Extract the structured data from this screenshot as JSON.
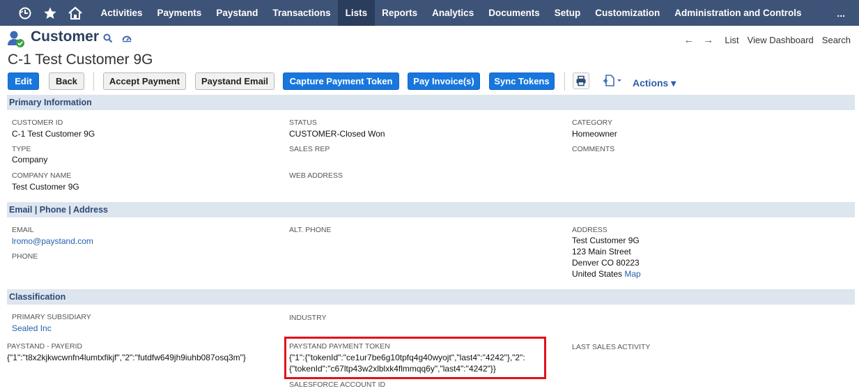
{
  "nav": {
    "items": [
      "Activities",
      "Payments",
      "Paystand",
      "Transactions",
      "Lists",
      "Reports",
      "Analytics",
      "Documents",
      "Setup",
      "Customization",
      "Administration and Controls"
    ],
    "active": "Lists",
    "more": "..."
  },
  "record": {
    "type": "Customer",
    "title": "C-1 Test Customer 9G"
  },
  "right_links": {
    "list": "List",
    "dashboard": "View Dashboard",
    "search": "Search"
  },
  "buttons": {
    "edit": "Edit",
    "back": "Back",
    "accept_payment": "Accept Payment",
    "paystand_email": "Paystand Email",
    "capture_token": "Capture Payment Token",
    "pay_invoices": "Pay Invoice(s)",
    "sync_tokens": "Sync Tokens",
    "actions": "Actions ▾"
  },
  "sections": {
    "primary": "Primary Information",
    "contact": "Email | Phone | Address",
    "classification": "Classification"
  },
  "primary": {
    "customer_id_label": "CUSTOMER ID",
    "customer_id": "C-1 Test Customer 9G",
    "type_label": "TYPE",
    "type": "Company",
    "company_name_label": "COMPANY NAME",
    "company_name": "Test Customer 9G",
    "status_label": "STATUS",
    "status": "CUSTOMER-Closed Won",
    "sales_rep_label": "SALES REP",
    "web_address_label": "WEB ADDRESS",
    "category_label": "CATEGORY",
    "category": "Homeowner",
    "comments_label": "COMMENTS"
  },
  "contact": {
    "email_label": "EMAIL",
    "email": "lromo@paystand.com",
    "phone_label": "PHONE",
    "alt_phone_label": "ALT. PHONE",
    "address_label": "ADDRESS",
    "address_line1": "Test Customer 9G",
    "address_line2": "123 Main Street",
    "address_line3": "Denver CO 80223",
    "address_line4": "United States",
    "map_link": "Map"
  },
  "classification": {
    "subsidiary_label": "PRIMARY SUBSIDIARY",
    "subsidiary": "Sealed Inc",
    "industry_label": "INDUSTRY",
    "payerid_label": "PAYSTAND - PAYERID",
    "payerid": "{\"1\":\"t8x2kjkwcwnfn4lumtxfikjf\",\"2\":\"futdfw649jh9iuhb087osq3m\"}",
    "token_label": "PAYSTAND PAYMENT TOKEN",
    "token_line1": "{\"1\":{\"tokenId\":\"ce1ur7be6g10tpfq4g40wyojt\",\"last4\":\"4242\"},\"2\":",
    "token_line2": "{\"tokenId\":\"c67ltp43w2xlblxk4flmmqq6y\",\"last4\":\"4242\"}}",
    "sf_account_label": "SALESFORCE ACCOUNT ID",
    "last_sales_label": "LAST SALES ACTIVITY"
  },
  "colors": {
    "nav_bg": "#3e5378",
    "button_blue": "#1877dd",
    "section_bg": "#dde5ef",
    "highlight_red": "#e3101a"
  }
}
